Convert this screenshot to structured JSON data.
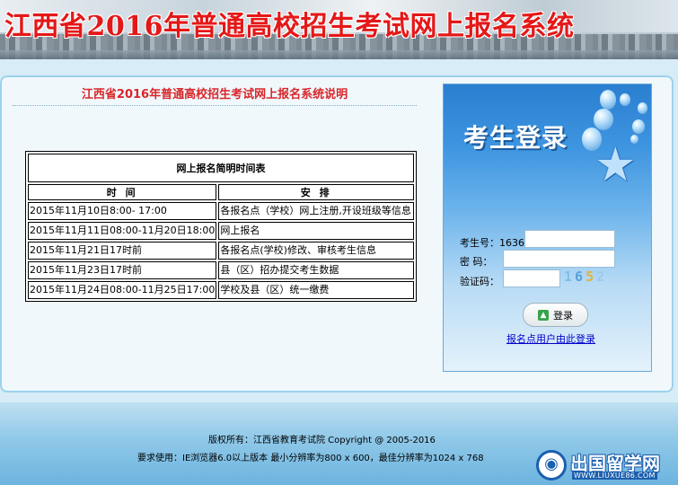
{
  "banner": {
    "title": "江西省2016年普通高校招生考试网上报名系统"
  },
  "intro": {
    "title": "江西省2016年普通高校招生考试网上报名系统说明"
  },
  "schedule": {
    "caption": "网上报名简明时间表",
    "headers": [
      "时  间",
      "安  排"
    ],
    "rows": [
      [
        "2015年11月10日8:00- 17:00",
        "各报名点（学校）网上注册,开设班级等信息"
      ],
      [
        "2015年11月11日08:00-11月20日18:00",
        "网上报名"
      ],
      [
        "2015年11月21日17时前",
        "各报名点(学校)修改、审核考生信息"
      ],
      [
        "2015年11月23日17时前",
        "县（区）招办提交考生数据"
      ],
      [
        "2015年11月24日08:00-11月25日17:00",
        "学校及县（区）统一缴费"
      ]
    ]
  },
  "login": {
    "title": "考生登录",
    "exam_no_label": "考生号：",
    "exam_no_value": "1636",
    "password_label": "密  码：",
    "captcha_label": "验证码：",
    "captcha_digits": [
      "1",
      "6",
      "5",
      "2"
    ],
    "submit_label": "登录",
    "site_link": "报名点用户由此登录",
    "icons": {
      "submit": "up-arrow-icon",
      "decor": "star-icon"
    }
  },
  "footer": {
    "line1": "版权所有：江西省教育考试院 Copyright @ 2005-2016",
    "line2": "要求使用：IE浏览器6.0以上版本 最小分辨率为800 x 600，最佳分辨率为1024 x 768"
  },
  "watermark": {
    "name": "出国留学网",
    "url": "WWW.LIUXUE86.COM"
  },
  "colors": {
    "banner_title": "#e41818",
    "intro_title": "#d9262a",
    "link": "#0000cc",
    "login_card": "#3e95e0"
  }
}
